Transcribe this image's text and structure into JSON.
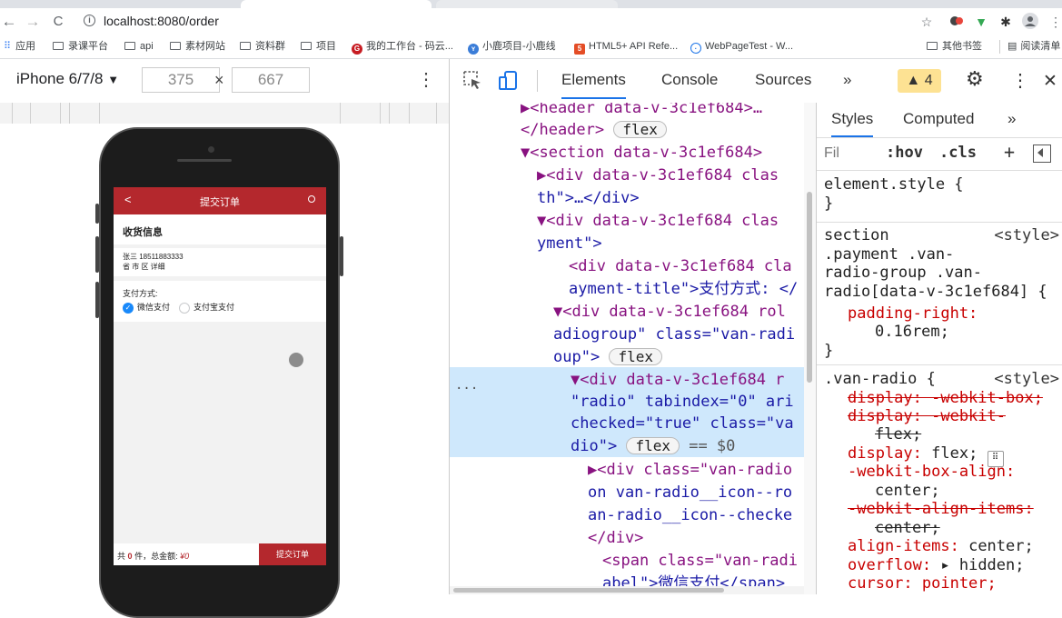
{
  "browser": {
    "url": "localhost:8080/order",
    "info_icon": "i",
    "nav": {
      "back": "←",
      "forward": "→",
      "reload": "C"
    }
  },
  "bookmarks": {
    "apps": "应用",
    "items": [
      "录课平台",
      "api",
      "素材网站",
      "资料群",
      "项目",
      "我的工作台 - 码云...",
      "小鹿项目-小鹿线",
      "HTML5+ API Refe...",
      "WebPageTest - W..."
    ],
    "other": "其他书签",
    "reading": "阅读清单"
  },
  "device_toolbar": {
    "device": "iPhone 6/7/8",
    "device_arrow": "▼",
    "width": "375",
    "times": "×",
    "height": "667",
    "more": "⋮"
  },
  "app": {
    "nav_title": "提交订单",
    "back": "<",
    "receiver_title": "收货信息",
    "name_phone": "张三 18511883333",
    "address": "省 市 区 详细",
    "payment_title": "支付方式:",
    "options": [
      "微信支付",
      "支付宝支付"
    ],
    "footer": {
      "prefix": "共",
      "count": "0",
      "mid": "件，总金额:",
      "amount": "¥0"
    },
    "submit": "提交订单"
  },
  "devtools": {
    "tabs": [
      "Elements",
      "Console",
      "Sources"
    ],
    "more_tabs": "»",
    "warnings": "▲ 4",
    "close": "✕",
    "gear": "⚙",
    "kebab": "⋮",
    "dom": {
      "l1": "▶<header data-v-3c1ef684>…",
      "l2": "</header>",
      "l3": "▼<section data-v-3c1ef684>",
      "l4": "▶<div data-v-3c1ef684 clas",
      "l5": "th\">…</div>",
      "l6": "▼<div data-v-3c1ef684 clas",
      "l7": "yment\">",
      "l8": "<div data-v-3c1ef684 cla",
      "l9": "ayment-title\">支付方式: </",
      "l10": "▼<div data-v-3c1ef684 rol",
      "l11": "adiogroup\" class=\"van-radi",
      "l12": "oup\">",
      "l13": "▼<div data-v-3c1ef684 r",
      "l14": "\"radio\" tabindex=\"0\" ari",
      "l15": "checked=\"true\" class=\"va",
      "l16": "dio\">",
      "l16b": "== $0",
      "l17": "▶<div class=\"van-radio",
      "l18": "on van-radio__icon--ro",
      "l19": "an-radio__icon--checke",
      "l20": "</div>",
      "l21": "<span class=\"van-radi",
      "l22": "abel\">微信支付</span>",
      "ellipsis": "...",
      "flex": "flex"
    },
    "styles": {
      "tabs": [
        "Styles",
        "Computed"
      ],
      "more": "»",
      "filter": "Fil",
      "hov": ":hov",
      "cls": ".cls",
      "plus": "+",
      "element_style": "element.style {",
      "close_brace": "}",
      "rule2": {
        "l1": "section",
        "src": "<style>",
        "l2": ".payment .van-",
        "l3": "radio-group .van-",
        "l4": "radio[data-v-3c1ef684] {",
        "prop": "padding-right:",
        "val": "0.16rem;"
      },
      "rule3": {
        "sel": ".van-radio {",
        "src": "<style>",
        "d1": "display: -webkit-box;",
        "d2a": "display: -webkit-",
        "d2b": "flex;",
        "d3p": "display:",
        "d3v": "flex;",
        "d4p": "-webkit-box-align:",
        "d4v": "center;",
        "d5a": "-webkit-align-items:",
        "d5b": "center;",
        "d6p": "align-items:",
        "d6v": "center;",
        "d7p": "overflow:",
        "d7v": "▸ hidden;",
        "d8": "cursor: pointer;"
      }
    }
  }
}
